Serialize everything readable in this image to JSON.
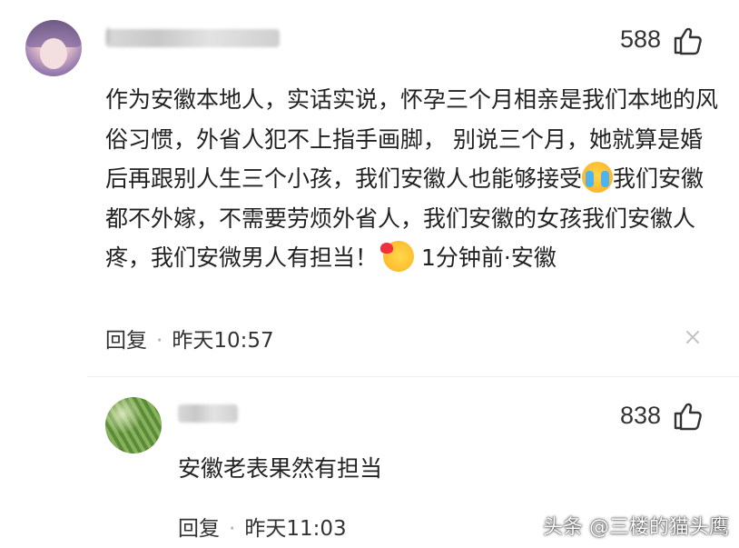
{
  "comment": {
    "username_masked": "I",
    "likes": "588",
    "text": "作为安徽本地人，实话实说，怀孕三个月相亲是我们本地的风俗习惯，外省人犯不上指手画脚， 别说三个月，她就算是婚后再跟别人生三个小孩，我们安徽人也能够接受",
    "text_after_emoji": "我们安徽都不外嫁，不需要劳烦外省人，我们安徽的女孩我们安徽人疼，我们安微男人有担当！",
    "meta_inline": " 1分钟前·安徽",
    "reply_label": "回复",
    "dot": "·",
    "time": "昨天10:57",
    "close_icon": "close-icon",
    "emoji_1": "crying-laughing-emoji",
    "emoji_2": "kiss-emoji"
  },
  "sub_comment": {
    "likes": "838",
    "text": "安徽老表果然有担当",
    "reply_label": "回复",
    "dot": "·",
    "time": "昨天11:03"
  },
  "watermark": "头条 @三楼的猫头鹰",
  "colors": {
    "text_primary": "#222222",
    "text_secondary": "#333333",
    "dot": "#aaaaaa",
    "close": "#bdbdbd"
  }
}
